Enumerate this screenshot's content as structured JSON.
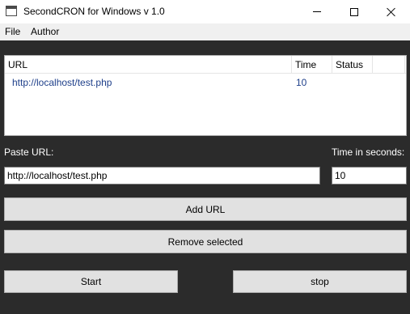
{
  "window": {
    "title": "SecondCRON for Windows v 1.0"
  },
  "menu": {
    "items": [
      "File",
      "Author"
    ]
  },
  "list": {
    "columns": [
      "URL",
      "Time",
      "Status",
      ""
    ],
    "rows": [
      {
        "url": "http://localhost/test.php",
        "time": "10",
        "status": ""
      }
    ]
  },
  "form": {
    "url_label": "Paste URL:",
    "url_value": "http://localhost/test.php",
    "time_label": "Time in seconds:",
    "time_value": "10"
  },
  "buttons": {
    "add": "Add URL",
    "remove": "Remove selected",
    "start": "Start",
    "stop": "stop"
  },
  "colors": {
    "background": "#2b2b2b",
    "button": "#e1e1e1",
    "link_text": "#1e3f8a"
  }
}
